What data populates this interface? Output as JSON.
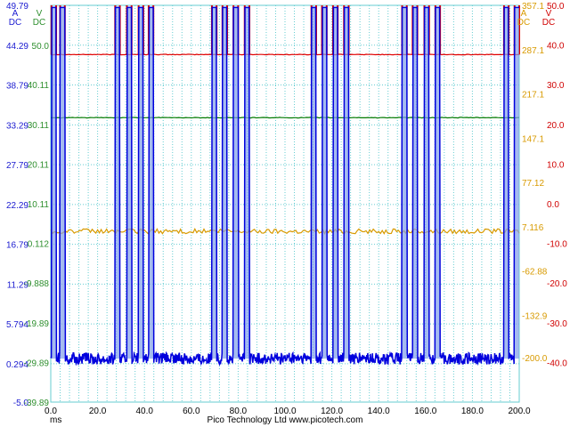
{
  "app": {
    "footer": "Pico Technology Ltd    www.picotech.com"
  },
  "colors": {
    "grid": "#66cdd2",
    "blue": "#0000dd",
    "blue_fill": "#7f9ee8",
    "red": "#e00000",
    "green": "#007a00",
    "orange": "#d89a00",
    "tick_blue": "#1a1ad0",
    "tick_green": "#2e8f2e",
    "tick_orange": "#d89a00",
    "tick_red": "#d00000"
  },
  "chart_data": {
    "type": "line",
    "xlabel": "ms",
    "xlim": [
      0,
      200
    ],
    "x_ticks": [
      "0.0",
      "20.0",
      "40.0",
      "60.0",
      "80.0",
      "100.0",
      "120.0",
      "140.0",
      "160.0",
      "180.0",
      "200.0"
    ],
    "axes": [
      {
        "side": "left",
        "unit_line1": "A",
        "unit_line2": "DC",
        "color": "blue",
        "ylim": [
          -5.0,
          49.79
        ],
        "ticks": [
          "49.79",
          "44.29",
          "38.79",
          "33.29",
          "27.79",
          "22.29",
          "16.79",
          "11.29",
          "5.794",
          "0.294",
          "-5.0"
        ]
      },
      {
        "side": "left",
        "unit_line1": "V",
        "unit_line2": "DC",
        "color": "green",
        "ylim": [
          -39.89,
          60.11
        ],
        "ticks": [
          "50.0",
          "40.11",
          "30.11",
          "20.11",
          "10.11",
          "0.112",
          "-9.888",
          "-19.89",
          "-29.89",
          "-39.89"
        ]
      },
      {
        "side": "right",
        "unit_line1": "A",
        "unit_line2": "DC",
        "color": "orange",
        "ylim": [
          -270.0,
          357.1
        ],
        "ticks": [
          "357.1",
          "287.1",
          "217.1",
          "147.1",
          "77.12",
          "7.116",
          "-62.88",
          "-132.9",
          "-200.0"
        ]
      },
      {
        "side": "right",
        "unit_line1": "V",
        "unit_line2": "DC",
        "color": "red",
        "ylim": [
          -50.0,
          50.0
        ],
        "ticks": [
          "50.0",
          "40.0",
          "30.0",
          "20.0",
          "10.0",
          "0.0",
          "-10.0",
          "-20.0",
          "-30.0",
          "-40.0"
        ]
      }
    ],
    "series": [
      {
        "color": "blue",
        "axis": 0,
        "baseline": 1.0,
        "pulse_high": 49.5,
        "pulse_starts": [
          0.3,
          4.0,
          27.5,
          32.5,
          37.5,
          41.8,
          68.8,
          73.3,
          78.0,
          82.8,
          111.3,
          115.8,
          120.5,
          125.2,
          150.0,
          154.5,
          159.5,
          164.2,
          193.5,
          198.0
        ],
        "pulse_width": 2.0
      },
      {
        "color": "red",
        "axis": 3,
        "level": 37.6
      },
      {
        "color": "green",
        "axis": 1,
        "level": 31.8
      },
      {
        "color": "orange",
        "axis": 2,
        "level": 0.0
      }
    ]
  }
}
